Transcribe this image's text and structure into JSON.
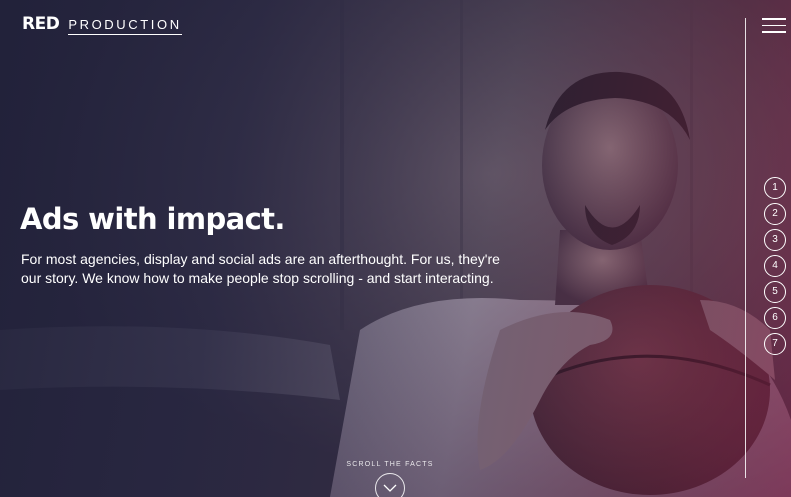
{
  "header": {
    "logo_primary": "RED",
    "logo_secondary": "PRODUCTION",
    "menu_icon": "hamburger-menu-icon"
  },
  "section_nav": {
    "items": [
      "1",
      "2",
      "3",
      "4",
      "5",
      "6",
      "7"
    ]
  },
  "hero": {
    "title": "Ads with impact.",
    "body": "For most agencies, display and social ads are an afterthought. For us, they're our story. We know how to make people stop scrolling - and start interacting."
  },
  "scroll": {
    "label": "SCROLL THE FACTS",
    "icon": "chevron-down-icon"
  },
  "colors": {
    "text": "#ffffff",
    "background_dark": "#232336",
    "accent_magenta": "#962850"
  }
}
